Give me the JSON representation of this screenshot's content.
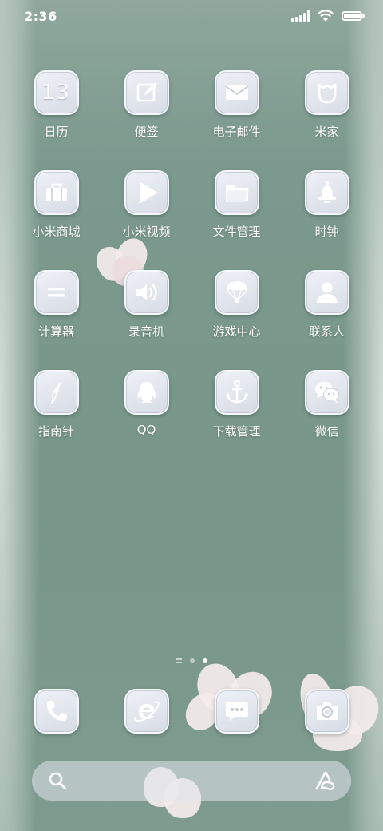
{
  "status_bar": {
    "time": "2:36",
    "signal_bars": 5,
    "battery_level": 0.95,
    "icons": [
      "signal-icon",
      "wifi-icon",
      "battery-icon"
    ]
  },
  "home": {
    "apps": [
      {
        "label": "日历",
        "icon": "calendar-icon",
        "icon_text": "13"
      },
      {
        "label": "便签",
        "icon": "notes-icon"
      },
      {
        "label": "电子邮件",
        "icon": "email-icon"
      },
      {
        "label": "米家",
        "icon": "mijia-icon"
      },
      {
        "label": "小米商城",
        "icon": "shopping-bag-icon"
      },
      {
        "label": "小米视频",
        "icon": "play-icon"
      },
      {
        "label": "文件管理",
        "icon": "folder-icon"
      },
      {
        "label": "时钟",
        "icon": "alarm-bell-icon"
      },
      {
        "label": "计算器",
        "icon": "calculator-icon"
      },
      {
        "label": "录音机",
        "icon": "speaker-icon"
      },
      {
        "label": "游戏中心",
        "icon": "parachute-icon"
      },
      {
        "label": "联系人",
        "icon": "contact-person-icon"
      },
      {
        "label": "指南针",
        "icon": "compass-icon"
      },
      {
        "label": "QQ",
        "icon": "qq-penguin-icon"
      },
      {
        "label": "下载管理",
        "icon": "anchor-icon"
      },
      {
        "label": "微信",
        "icon": "wechat-icon"
      }
    ]
  },
  "page_indicator": {
    "pages": 2,
    "active_page": 2
  },
  "dock": {
    "apps": [
      {
        "label": "Phone",
        "icon": "phone-icon"
      },
      {
        "label": "Browser",
        "icon": "browser-icon"
      },
      {
        "label": "Messages",
        "icon": "message-bubble-icon"
      },
      {
        "label": "Camera",
        "icon": "camera-icon"
      }
    ]
  },
  "search": {
    "icons": [
      "search-icon",
      "assistant-icon"
    ]
  },
  "colors": {
    "wallpaper": "#7c998e",
    "icon_face": "#e3e7ee",
    "icon_border": "#f5f7fa",
    "label_text": "#ffffff"
  }
}
